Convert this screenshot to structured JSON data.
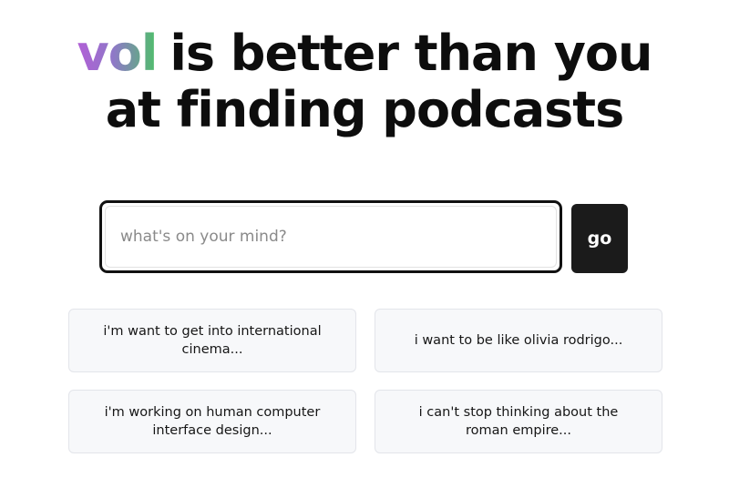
{
  "headline": {
    "brand": "vol",
    "line1_rest": "is better than you",
    "line2": "at finding podcasts"
  },
  "search": {
    "placeholder": "what's on your mind?",
    "value": "",
    "go_label": "go"
  },
  "suggestions": [
    {
      "label": "i'm want to get into international cinema..."
    },
    {
      "label": "i want to be like olivia rodrigo..."
    },
    {
      "label": "i'm working on human computer interface design..."
    },
    {
      "label": "i can't stop thinking about the roman empire..."
    }
  ],
  "colors": {
    "brand_gradient_start": "#b15fd6",
    "brand_gradient_end": "#4fbf6a",
    "go_button_bg": "#1b1b1b",
    "suggestion_bg": "#f7f8fa"
  }
}
